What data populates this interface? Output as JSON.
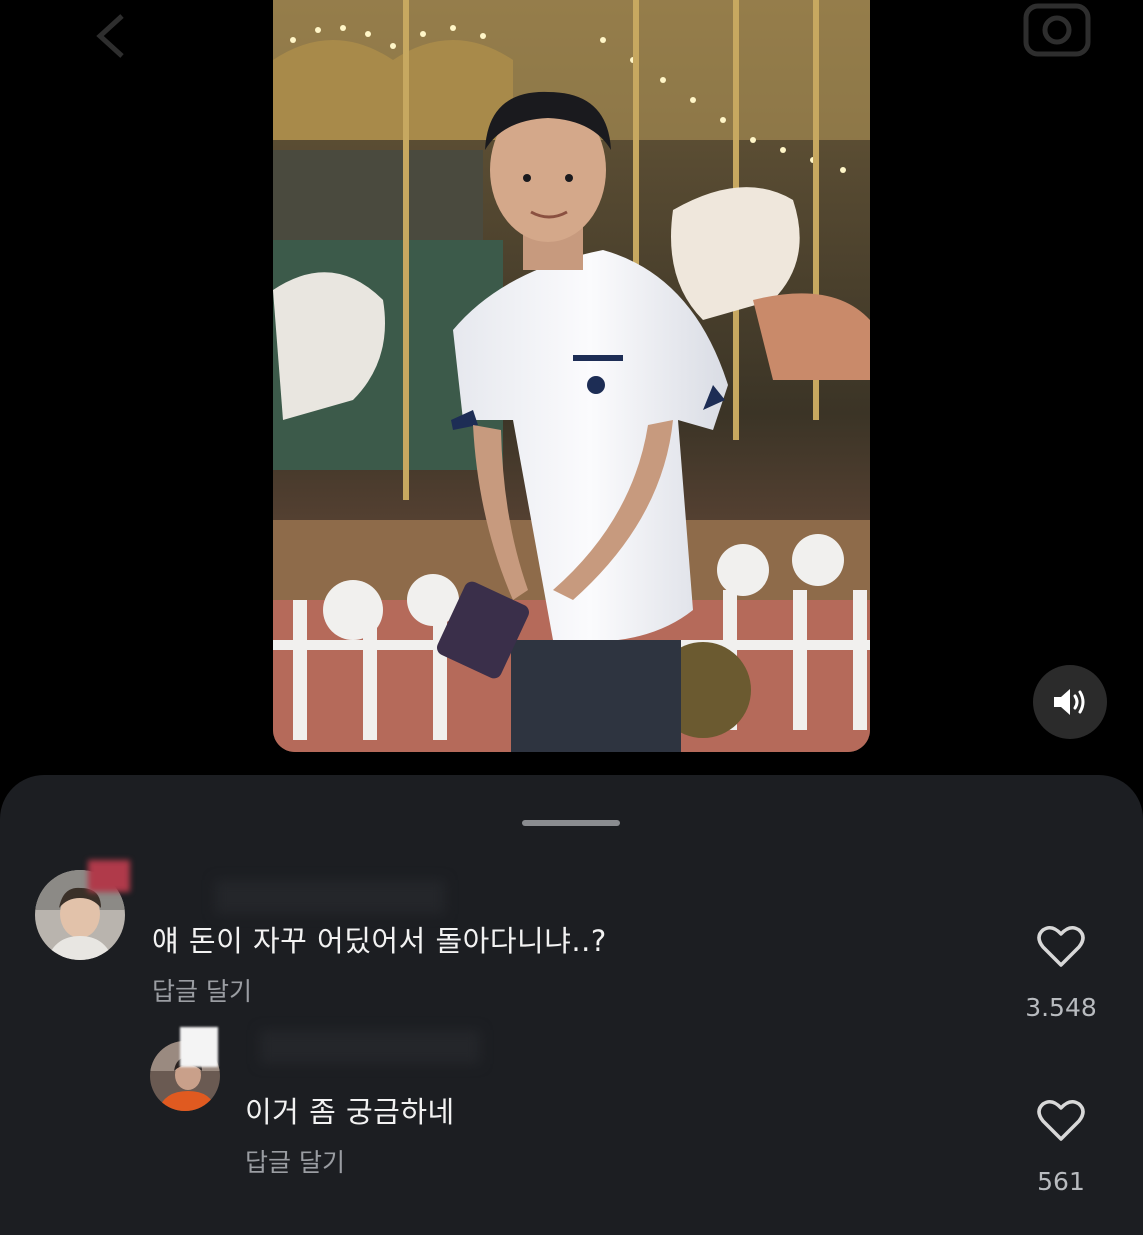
{
  "top_bar": {
    "back_icon": "chevron-left-icon",
    "camera_icon": "camera-icon"
  },
  "video": {
    "description_icon": "video-frame"
  },
  "volume": {
    "icon": "speaker-on-icon"
  },
  "comments": [
    {
      "text": "얘 돈이 자꾸 어딨어서 돌아다니냐..?",
      "reply_label": "답글 달기",
      "like_count": "3.548"
    },
    {
      "text": "이거 좀 궁금하네",
      "reply_label": "답글 달기",
      "like_count": "561"
    }
  ],
  "colors": {
    "background": "#000000",
    "sheet": "#1c1e22",
    "text": "#f2f2f2",
    "muted": "#9a9da2"
  }
}
